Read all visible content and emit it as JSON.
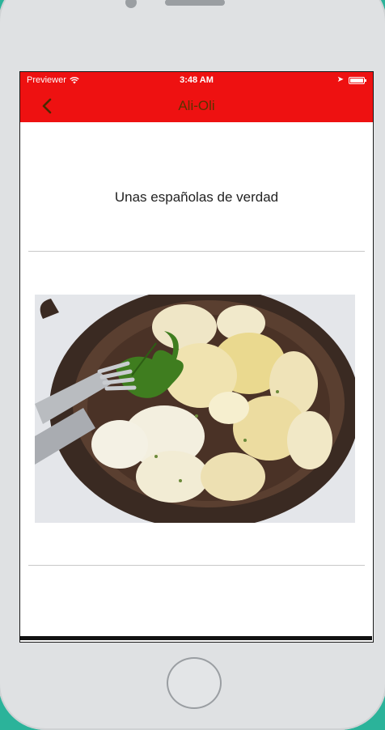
{
  "status_bar": {
    "carrier": "Previewer",
    "time": "3:48 AM"
  },
  "nav": {
    "title": "Ali-Oli"
  },
  "content": {
    "subtitle": "Unas españolas de verdad"
  },
  "icons": {
    "back": "chevron-left-icon",
    "wifi": "wifi-icon",
    "location": "location-arrow-icon",
    "battery": "battery-icon"
  },
  "colors": {
    "header": "#ee1111",
    "background": "#2bb39a",
    "phone_body": "#dfe1e3"
  }
}
